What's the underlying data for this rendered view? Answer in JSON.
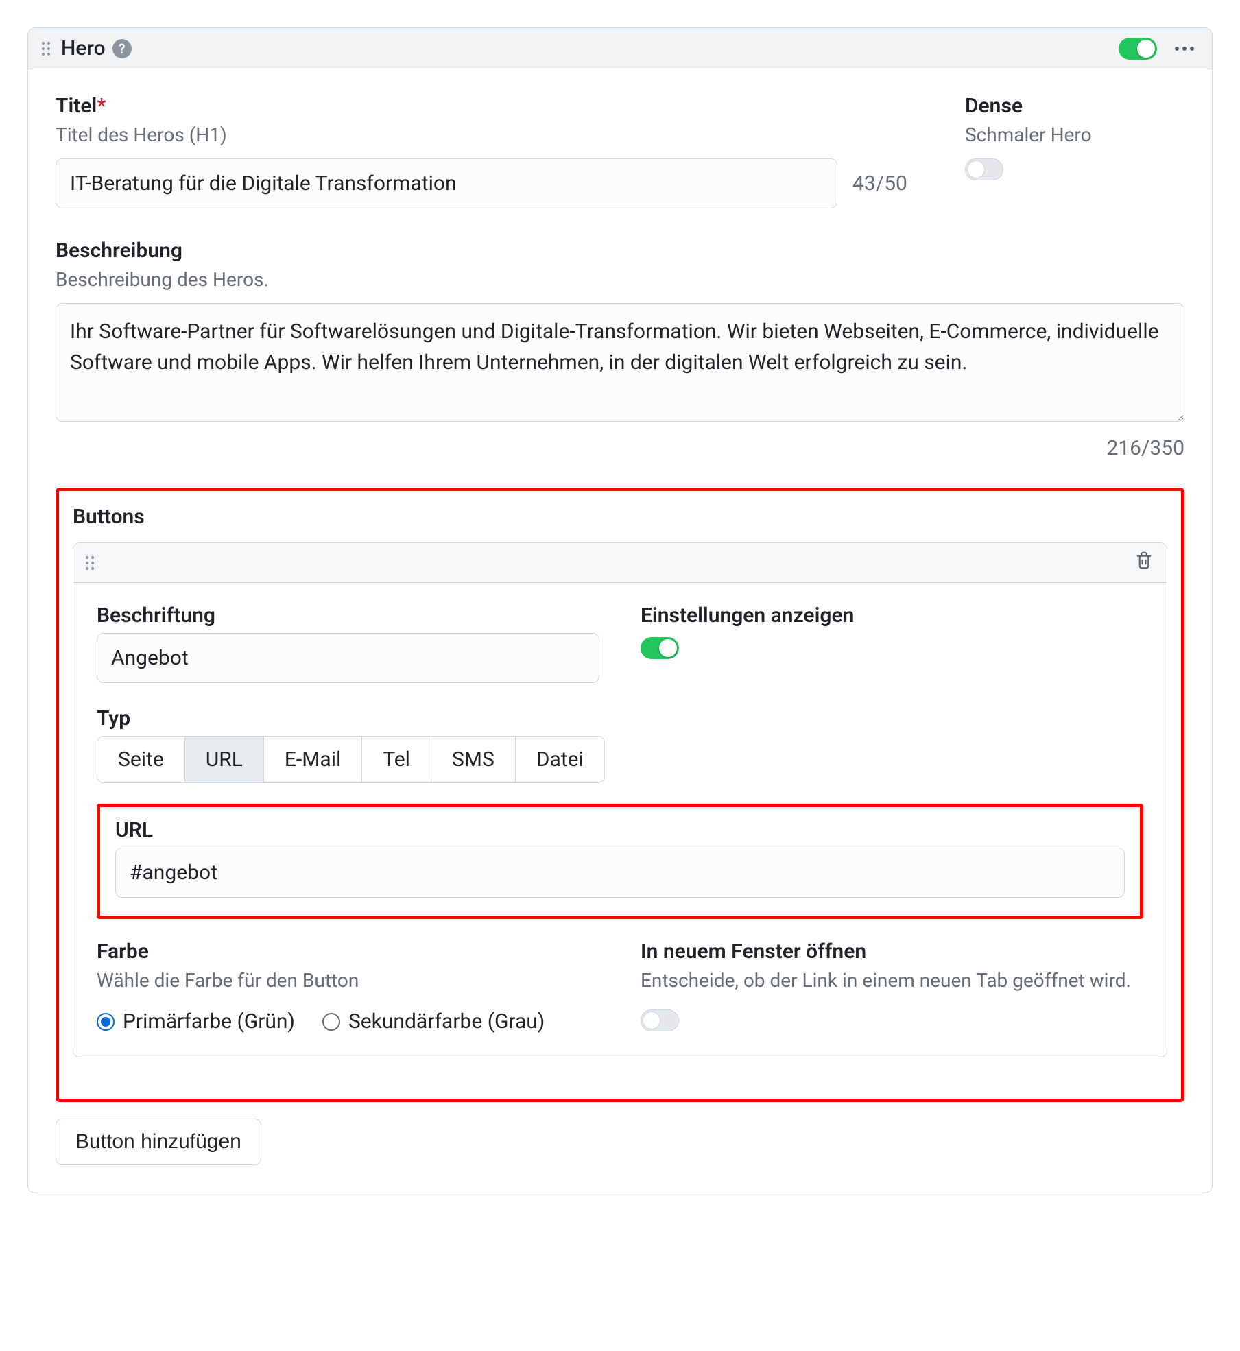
{
  "panel": {
    "title": "Hero",
    "enabled": true
  },
  "titel": {
    "label": "Titel",
    "hint": "Titel des Heros (H1)",
    "value": "IT-Beratung für die Digitale Transformation",
    "counter": "43/50"
  },
  "dense": {
    "label": "Dense",
    "hint": "Schmaler Hero",
    "value": false
  },
  "beschreibung": {
    "label": "Beschreibung",
    "hint": "Beschreibung des Heros.",
    "value": "Ihr Software-Partner für Softwarelösungen und Digitale-Transformation. Wir bieten Webseiten, E-Commerce, individuelle Software und mobile Apps. Wir helfen Ihrem Unternehmen, in der digitalen Welt erfolgreich zu sein.",
    "counter": "216/350"
  },
  "buttons": {
    "section_label": "Buttons",
    "add_label": "Button hinzufügen",
    "item": {
      "beschriftung_label": "Beschriftung",
      "beschriftung_value": "Angebot",
      "einstellungen_label": "Einstellungen anzeigen",
      "einstellungen_value": true,
      "typ_label": "Typ",
      "typ_options": {
        "seite": "Seite",
        "url": "URL",
        "email": "E-Mail",
        "tel": "Tel",
        "sms": "SMS",
        "datei": "Datei"
      },
      "typ_selected": "url",
      "url_label": "URL",
      "url_value": "#angebot",
      "farbe_label": "Farbe",
      "farbe_hint": "Wähle die Farbe für den Button",
      "farbe_options": {
        "primary": "Primärfarbe (Grün)",
        "secondary": "Sekundärfarbe (Grau)"
      },
      "farbe_selected": "primary",
      "newtab_label": "In neuem Fenster öffnen",
      "newtab_hint": "Entscheide, ob der Link in einem neuen Tab geöffnet wird.",
      "newtab_value": false
    }
  }
}
